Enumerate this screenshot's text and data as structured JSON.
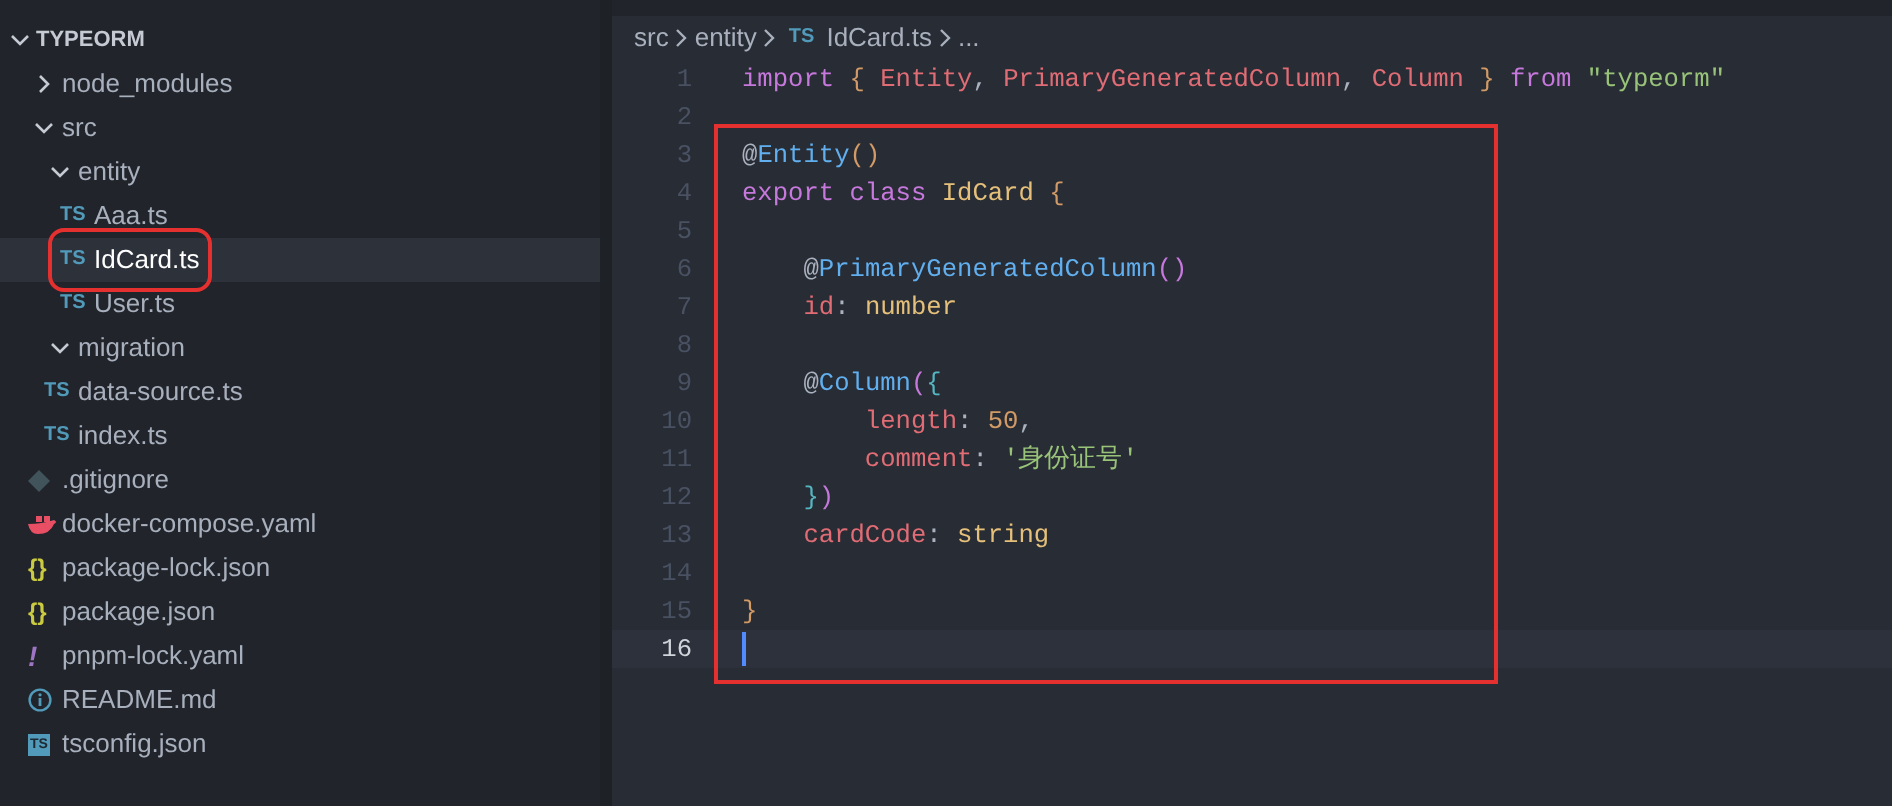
{
  "explorer": {
    "title": "TYPEORM",
    "expanded": true,
    "items": [
      {
        "label": "node_modules",
        "kind": "folder",
        "expanded": false,
        "selected": false,
        "highlighted": false
      },
      {
        "label": "src",
        "kind": "folder",
        "expanded": true,
        "selected": false,
        "highlighted": false,
        "children": [
          {
            "label": "entity",
            "kind": "folder",
            "expanded": true,
            "selected": false,
            "highlighted": false,
            "children": [
              {
                "label": "Aaa.ts",
                "kind": "badge",
                "badge": "TS",
                "selected": false,
                "highlighted": false
              },
              {
                "label": "IdCard.ts",
                "kind": "badge",
                "badge": "TS",
                "selected": true,
                "highlighted": true
              },
              {
                "label": "User.ts",
                "kind": "badge",
                "badge": "TS",
                "selected": false,
                "highlighted": false
              }
            ]
          },
          {
            "label": "migration",
            "kind": "folder",
            "expanded": true,
            "selected": false,
            "highlighted": false
          },
          {
            "label": "data-source.ts",
            "kind": "badge",
            "badge": "TS",
            "selected": false,
            "highlighted": false
          },
          {
            "label": "index.ts",
            "kind": "badge",
            "badge": "TS",
            "selected": false,
            "highlighted": false
          }
        ]
      },
      {
        "label": ".gitignore",
        "kind": "diamond",
        "selected": false,
        "highlighted": false
      },
      {
        "label": "docker-compose.yaml",
        "kind": "whale",
        "selected": false,
        "highlighted": false
      },
      {
        "label": "package-lock.json",
        "kind": "badge",
        "badge": "{}",
        "selected": false,
        "highlighted": false
      },
      {
        "label": "package.json",
        "kind": "badge",
        "badge": "{}",
        "selected": false,
        "highlighted": false
      },
      {
        "label": "pnpm-lock.yaml",
        "kind": "badge",
        "badge": "!",
        "selected": false,
        "highlighted": false
      },
      {
        "label": "README.md",
        "kind": "info",
        "selected": false,
        "highlighted": false
      },
      {
        "label": "tsconfig.json",
        "kind": "square-badge",
        "badge": "TS",
        "selected": false,
        "highlighted": false
      }
    ]
  },
  "breadcrumb": [
    {
      "label": "src"
    },
    {
      "label": "entity"
    },
    {
      "label": "IdCard.ts",
      "badge": "TS"
    },
    {
      "label": "..."
    }
  ],
  "editor": {
    "lines": [
      {
        "number": "1",
        "current": false,
        "boxed": false,
        "tokens": [
          {
            "kind": "keyword",
            "s": "import "
          },
          {
            "kind": "bracket",
            "s": "{ "
          },
          {
            "kind": "variable",
            "s": "Entity"
          },
          {
            "kind": "plain",
            "s": ", "
          },
          {
            "kind": "variable",
            "s": "PrimaryGeneratedColumn"
          },
          {
            "kind": "plain",
            "s": ", "
          },
          {
            "kind": "variable",
            "s": "Column "
          },
          {
            "kind": "bracket",
            "s": "} "
          },
          {
            "kind": "keyword",
            "s": "from "
          },
          {
            "kind": "string",
            "s": "\"typeorm\""
          }
        ]
      },
      {
        "number": "2",
        "current": false,
        "boxed": false
      },
      {
        "number": "3",
        "current": false,
        "boxed": true,
        "tokens": [
          {
            "kind": "plain",
            "s": "@"
          },
          {
            "kind": "function",
            "s": "Entity"
          },
          {
            "kind": "bracket",
            "s": "()"
          }
        ]
      },
      {
        "number": "4",
        "current": false,
        "boxed": true,
        "tokens": [
          {
            "kind": "keyword",
            "s": "export class "
          },
          {
            "kind": "type",
            "s": "IdCard "
          },
          {
            "kind": "bracket",
            "s": "{"
          }
        ]
      },
      {
        "number": "5",
        "current": false,
        "boxed": true
      },
      {
        "number": "6",
        "current": false,
        "boxed": true,
        "tokens": [
          {
            "kind": "plain",
            "s": "    @"
          },
          {
            "kind": "function",
            "s": "PrimaryGeneratedColumn"
          },
          {
            "kind": "bracket2",
            "s": "()"
          }
        ]
      },
      {
        "number": "7",
        "current": false,
        "boxed": true,
        "tokens": [
          {
            "kind": "variable",
            "s": "    id"
          },
          {
            "kind": "plain",
            "s": ": "
          },
          {
            "kind": "type",
            "s": "number"
          }
        ]
      },
      {
        "number": "8",
        "current": false,
        "boxed": true
      },
      {
        "number": "9",
        "current": false,
        "boxed": true,
        "tokens": [
          {
            "kind": "plain",
            "s": "    @"
          },
          {
            "kind": "function",
            "s": "Column"
          },
          {
            "kind": "bracket2",
            "s": "("
          },
          {
            "kind": "bracket3",
            "s": "{"
          }
        ]
      },
      {
        "number": "10",
        "current": false,
        "boxed": true,
        "tokens": [
          {
            "kind": "variable",
            "s": "        length"
          },
          {
            "kind": "plain",
            "s": ": "
          },
          {
            "kind": "number",
            "s": "50"
          },
          {
            "kind": "plain",
            "s": ","
          }
        ]
      },
      {
        "number": "11",
        "current": false,
        "boxed": true,
        "tokens": [
          {
            "kind": "variable",
            "s": "        comment"
          },
          {
            "kind": "plain",
            "s": ": "
          },
          {
            "kind": "string",
            "s": "'身份证号'"
          }
        ]
      },
      {
        "number": "12",
        "current": false,
        "boxed": true,
        "tokens": [
          {
            "kind": "bracket3",
            "s": "    }"
          },
          {
            "kind": "bracket2",
            "s": ")"
          }
        ]
      },
      {
        "number": "13",
        "current": false,
        "boxed": true,
        "tokens": [
          {
            "kind": "variable",
            "s": "    cardCode"
          },
          {
            "kind": "plain",
            "s": ": "
          },
          {
            "kind": "type",
            "s": "string"
          }
        ]
      },
      {
        "number": "14",
        "current": false,
        "boxed": true
      },
      {
        "number": "15",
        "current": false,
        "boxed": true,
        "tokens": [
          {
            "kind": "bracket",
            "s": "}"
          }
        ]
      },
      {
        "number": "16",
        "current": true,
        "boxed": true
      }
    ]
  }
}
